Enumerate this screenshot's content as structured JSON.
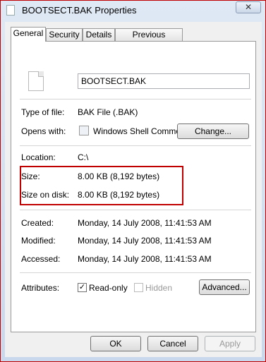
{
  "window": {
    "title": "BOOTSECT.BAK Properties",
    "close_label": "✕"
  },
  "tabs": [
    {
      "label": "General"
    },
    {
      "label": "Security"
    },
    {
      "label": "Details"
    },
    {
      "label": "Previous Versions"
    }
  ],
  "general": {
    "file_name": "BOOTSECT.BAK",
    "type_label": "Type of file:",
    "type_value": "BAK File (.BAK)",
    "opens_label": "Opens with:",
    "opens_value": "Windows Shell Commor",
    "change_label": "Change...",
    "location_label": "Location:",
    "location_value": "C:\\",
    "size_label": "Size:",
    "size_value": "8.00 KB (8,192 bytes)",
    "size_disk_label": "Size on disk:",
    "size_disk_value": "8.00 KB (8,192 bytes)",
    "created_label": "Created:",
    "created_value": "Monday, 14 July 2008, 11:41:53 AM",
    "modified_label": "Modified:",
    "modified_value": "Monday, 14 July 2008, 11:41:53 AM",
    "accessed_label": "Accessed:",
    "accessed_value": "Monday, 14 July 2008, 11:41:53 AM",
    "attributes_label": "Attributes:",
    "readonly_label": "Read-only",
    "readonly_checked": true,
    "hidden_label": "Hidden",
    "hidden_checked": false,
    "advanced_label": "Advanced..."
  },
  "footer": {
    "ok_label": "OK",
    "cancel_label": "Cancel",
    "apply_label": "Apply"
  },
  "colors": {
    "highlight": "#c00000",
    "window_border": "#c00000"
  }
}
